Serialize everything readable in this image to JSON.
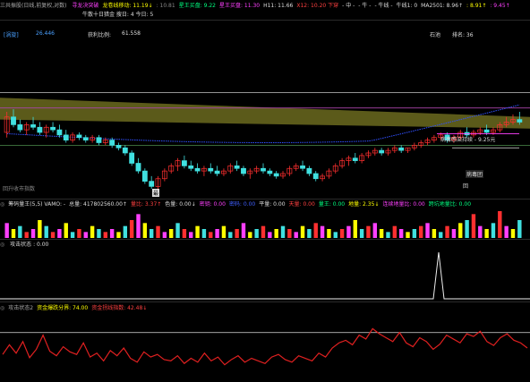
{
  "header_main": {
    "title": "三共振股(日线,前复权,对数)",
    "items": [
      {
        "label": "寻龙决突破",
        "color": "#ff40ff"
      },
      {
        "label": "龙卷线移动: 11.19↓",
        "color": "#ffff00"
      },
      {
        "label": ": 10.81",
        "color": "#888888"
      },
      {
        "label": "星王买盘: 9.22",
        "color": "#00ff80"
      },
      {
        "label": "星王买盘: 11.30",
        "color": "#ff40ff"
      },
      {
        "label": "H11: 11.66",
        "color": "#dddddd"
      },
      {
        "label": "X12: 10.20 下穿",
        "color": "#ff4040"
      },
      {
        "label": "- 中 -",
        "color": "#dddddd"
      },
      {
        "label": "- 牛 -",
        "color": "#dddddd"
      },
      {
        "label": "- 牛线 -",
        "color": "#dddddd"
      },
      {
        "label": "牛线1: 0",
        "color": "#dddddd"
      },
      {
        "label": "MA2501: 8.96↑",
        "color": "#dddddd"
      },
      {
        "label": ": 8.91↑",
        "color": "#ffff00"
      },
      {
        "label": ": 9.45↑",
        "color": "#ff40ff"
      }
    ],
    "line2": "牛散十日猎金  搜日: 4  今日: 5"
  },
  "info_bar": {
    "tag": "[涡旋]",
    "value1": "26.446",
    "label2": "获利比例:",
    "value2": "61.558",
    "label3": "石池",
    "label4": "排名: 36"
  },
  "chart_labels": {
    "left_bottom": "回升收市指数",
    "right_top": "病毒感染持续 - 9.25元",
    "right_mid": "病毒团",
    "right_low": "回",
    "bottom_marker": "最"
  },
  "volume_header": {
    "items": [
      {
        "label": "筹码量王(5,5) VAMO: -",
        "color": "#dddddd"
      },
      {
        "label": "总量: 417802560.00↑",
        "color": "#dddddd"
      },
      {
        "label": "量比: 3.37↑",
        "color": "#ff4040"
      },
      {
        "label": "色量: 0.00↓",
        "color": "#dddddd"
      },
      {
        "label": "密钥: 0.00",
        "color": "#ff40ff"
      },
      {
        "label": "密码: 0.00",
        "color": "#4060ff"
      },
      {
        "label": "平量: 0.00",
        "color": "#dddddd"
      },
      {
        "label": "天量: 0.00",
        "color": "#ff4040"
      },
      {
        "label": "量王: 0.00",
        "color": "#00ff80"
      },
      {
        "label": "地量: 2.35↓",
        "color": "#ffff00"
      },
      {
        "label": "连续地量比: 0.00",
        "color": "#ff40ff"
      },
      {
        "label": "跨坑地量比: 0.00",
        "color": "#00ff80"
      }
    ]
  },
  "attack_header": {
    "label": "攻击状态 : 0.00"
  },
  "attack2_header": {
    "items": [
      {
        "label": "攻击状态2",
        "color": "#aaaaaa"
      },
      {
        "label": "资金爆跌分界: 74.00",
        "color": "#ffff00"
      },
      {
        "label": "资金拐线指数: 42.48↓",
        "color": "#ff4040"
      }
    ]
  },
  "chart_data": [
    {
      "type": "candlestick",
      "title": "",
      "ohlc": [
        [
          10.6,
          11.4,
          10.4,
          11.2
        ],
        [
          11.2,
          11.5,
          10.8,
          10.9
        ],
        [
          10.9,
          11.1,
          10.6,
          10.7
        ],
        [
          10.7,
          11.0,
          10.5,
          10.9
        ],
        [
          10.9,
          11.2,
          10.7,
          10.8
        ],
        [
          10.8,
          11.0,
          10.5,
          10.6
        ],
        [
          10.6,
          10.9,
          10.4,
          10.8
        ],
        [
          10.8,
          11.0,
          10.6,
          10.7
        ],
        [
          10.7,
          10.9,
          10.4,
          10.5
        ],
        [
          10.5,
          10.7,
          10.2,
          10.3
        ],
        [
          10.3,
          10.6,
          10.2,
          10.5
        ],
        [
          10.5,
          10.6,
          10.3,
          10.4
        ],
        [
          10.4,
          10.5,
          10.2,
          10.3
        ],
        [
          10.3,
          10.5,
          10.2,
          10.4
        ],
        [
          10.4,
          10.5,
          10.1,
          10.2
        ],
        [
          10.2,
          10.4,
          10.1,
          10.3
        ],
        [
          10.3,
          10.4,
          10.0,
          10.1
        ],
        [
          10.1,
          10.2,
          9.9,
          10.0
        ],
        [
          10.0,
          10.1,
          9.7,
          9.8
        ],
        [
          9.8,
          9.9,
          9.3,
          9.4
        ],
        [
          9.4,
          9.6,
          9.0,
          9.1
        ],
        [
          9.1,
          9.2,
          8.6,
          8.7
        ],
        [
          8.7,
          8.9,
          8.4,
          8.5
        ],
        [
          8.5,
          8.9,
          8.4,
          8.8
        ],
        [
          8.8,
          9.2,
          8.7,
          9.1
        ],
        [
          9.1,
          9.4,
          9.0,
          9.3
        ],
        [
          9.3,
          9.6,
          9.1,
          9.5
        ],
        [
          9.5,
          9.7,
          9.2,
          9.3
        ],
        [
          9.3,
          9.5,
          9.1,
          9.2
        ],
        [
          9.2,
          9.4,
          9.0,
          9.1
        ],
        [
          9.1,
          9.3,
          8.9,
          9.2
        ],
        [
          9.2,
          9.4,
          9.0,
          9.1
        ],
        [
          9.1,
          9.3,
          8.9,
          9.0
        ],
        [
          9.0,
          9.2,
          8.9,
          9.1
        ],
        [
          9.1,
          9.4,
          9.0,
          9.3
        ],
        [
          9.3,
          9.5,
          9.1,
          9.2
        ],
        [
          9.2,
          9.3,
          8.9,
          9.0
        ],
        [
          9.0,
          9.2,
          8.8,
          9.1
        ],
        [
          9.1,
          9.3,
          9.0,
          9.2
        ],
        [
          9.2,
          9.4,
          9.0,
          9.1
        ],
        [
          9.1,
          9.2,
          8.9,
          9.0
        ],
        [
          9.0,
          9.1,
          8.8,
          8.9
        ],
        [
          8.9,
          9.1,
          8.8,
          9.0
        ],
        [
          9.0,
          9.3,
          8.9,
          9.2
        ],
        [
          9.2,
          9.4,
          9.1,
          9.3
        ],
        [
          9.3,
          9.5,
          9.1,
          9.2
        ],
        [
          9.2,
          9.3,
          8.9,
          9.0
        ],
        [
          9.0,
          9.1,
          8.7,
          8.8
        ],
        [
          8.8,
          9.0,
          8.7,
          8.9
        ],
        [
          8.9,
          9.2,
          8.8,
          9.1
        ],
        [
          9.1,
          9.4,
          9.0,
          9.3
        ],
        [
          9.3,
          9.6,
          9.2,
          9.5
        ],
        [
          9.5,
          9.7,
          9.3,
          9.6
        ],
        [
          9.6,
          9.8,
          9.4,
          9.5
        ],
        [
          9.5,
          9.8,
          9.4,
          9.7
        ],
        [
          9.7,
          9.9,
          9.6,
          9.8
        ],
        [
          9.8,
          10.0,
          9.7,
          9.9
        ],
        [
          9.9,
          10.0,
          9.7,
          9.8
        ],
        [
          9.8,
          10.0,
          9.7,
          9.9
        ],
        [
          9.9,
          10.1,
          9.8,
          10.0
        ],
        [
          10.0,
          10.1,
          9.8,
          9.9
        ],
        [
          9.9,
          10.0,
          9.8,
          10.0
        ],
        [
          10.0,
          10.2,
          9.9,
          10.1
        ],
        [
          10.1,
          10.3,
          10.0,
          10.2
        ],
        [
          10.2,
          10.4,
          10.1,
          10.3
        ],
        [
          10.3,
          10.5,
          10.2,
          10.4
        ],
        [
          10.4,
          10.6,
          10.3,
          10.5
        ],
        [
          10.5,
          10.6,
          10.2,
          10.3
        ],
        [
          10.3,
          10.5,
          10.2,
          10.4
        ],
        [
          10.4,
          10.7,
          10.3,
          10.6
        ],
        [
          10.6,
          10.8,
          10.4,
          10.5
        ],
        [
          10.5,
          10.7,
          10.4,
          10.6
        ],
        [
          10.6,
          10.8,
          10.5,
          10.7
        ],
        [
          10.7,
          10.9,
          10.5,
          10.6
        ],
        [
          10.6,
          10.8,
          10.5,
          10.7
        ],
        [
          10.7,
          11.0,
          10.6,
          10.9
        ],
        [
          10.9,
          11.2,
          10.8,
          11.0
        ],
        [
          11.0,
          11.3,
          10.9,
          11.1
        ],
        [
          11.1,
          11.4,
          10.9,
          11.0
        ]
      ],
      "ma_blue": [
        11.3,
        11.2,
        11.1,
        11.0,
        10.95,
        10.9,
        10.85,
        10.8,
        10.75,
        10.7
      ],
      "ylim": [
        8.2,
        12.2
      ]
    },
    {
      "type": "bar",
      "title": "",
      "values": [
        5,
        3,
        4,
        2,
        3,
        6,
        4,
        2,
        3,
        5,
        2,
        3,
        2,
        4,
        3,
        2,
        3,
        2,
        4,
        6,
        8,
        5,
        3,
        4,
        2,
        3,
        5,
        3,
        2,
        4,
        3,
        2,
        3,
        4,
        2,
        3,
        5,
        2,
        3,
        4,
        2,
        3,
        4,
        3,
        2,
        4,
        3,
        5,
        4,
        3,
        2,
        3,
        4,
        6,
        3,
        4,
        5,
        3,
        2,
        4,
        3,
        2,
        3,
        4,
        5,
        3,
        2,
        4,
        3,
        5,
        6,
        8,
        4,
        3,
        5,
        9,
        4,
        3,
        6
      ]
    },
    {
      "type": "line",
      "title": "",
      "values": [
        0,
        0,
        0,
        0,
        0,
        0,
        0,
        0,
        0,
        0,
        0,
        0,
        0,
        0,
        0,
        0,
        0,
        0,
        0,
        0,
        0,
        0,
        0,
        0,
        0,
        0,
        0,
        0,
        0,
        0,
        0,
        0,
        0,
        0,
        0,
        0,
        0,
        0,
        0,
        0,
        0,
        0,
        0,
        0,
        0,
        0,
        0,
        0,
        0,
        0,
        0,
        0,
        0,
        0,
        0,
        0,
        0,
        0,
        0,
        0,
        0,
        0,
        0,
        0,
        0,
        0,
        0,
        0,
        0,
        0,
        0,
        0,
        0,
        0,
        0,
        0,
        1,
        0,
        0
      ],
      "ylim": [
        0,
        1
      ]
    },
    {
      "type": "line",
      "title": "",
      "values": [
        40,
        55,
        42,
        60,
        35,
        48,
        70,
        45,
        38,
        52,
        44,
        40,
        58,
        36,
        42,
        30,
        46,
        38,
        50,
        34,
        28,
        44,
        36,
        40,
        32,
        30,
        38,
        26,
        34,
        28,
        42,
        30,
        36,
        24,
        32,
        38,
        28,
        34,
        30,
        26,
        36,
        40,
        32,
        28,
        38,
        34,
        30,
        42,
        36,
        50,
        58,
        62,
        55,
        70,
        64,
        80,
        72,
        66,
        60,
        74,
        58,
        52,
        66,
        60,
        48,
        56,
        70,
        64,
        58,
        72,
        68,
        76,
        60,
        54,
        66,
        72,
        62,
        58,
        50
      ],
      "threshold": 74,
      "ylim": [
        0,
        100
      ]
    }
  ]
}
